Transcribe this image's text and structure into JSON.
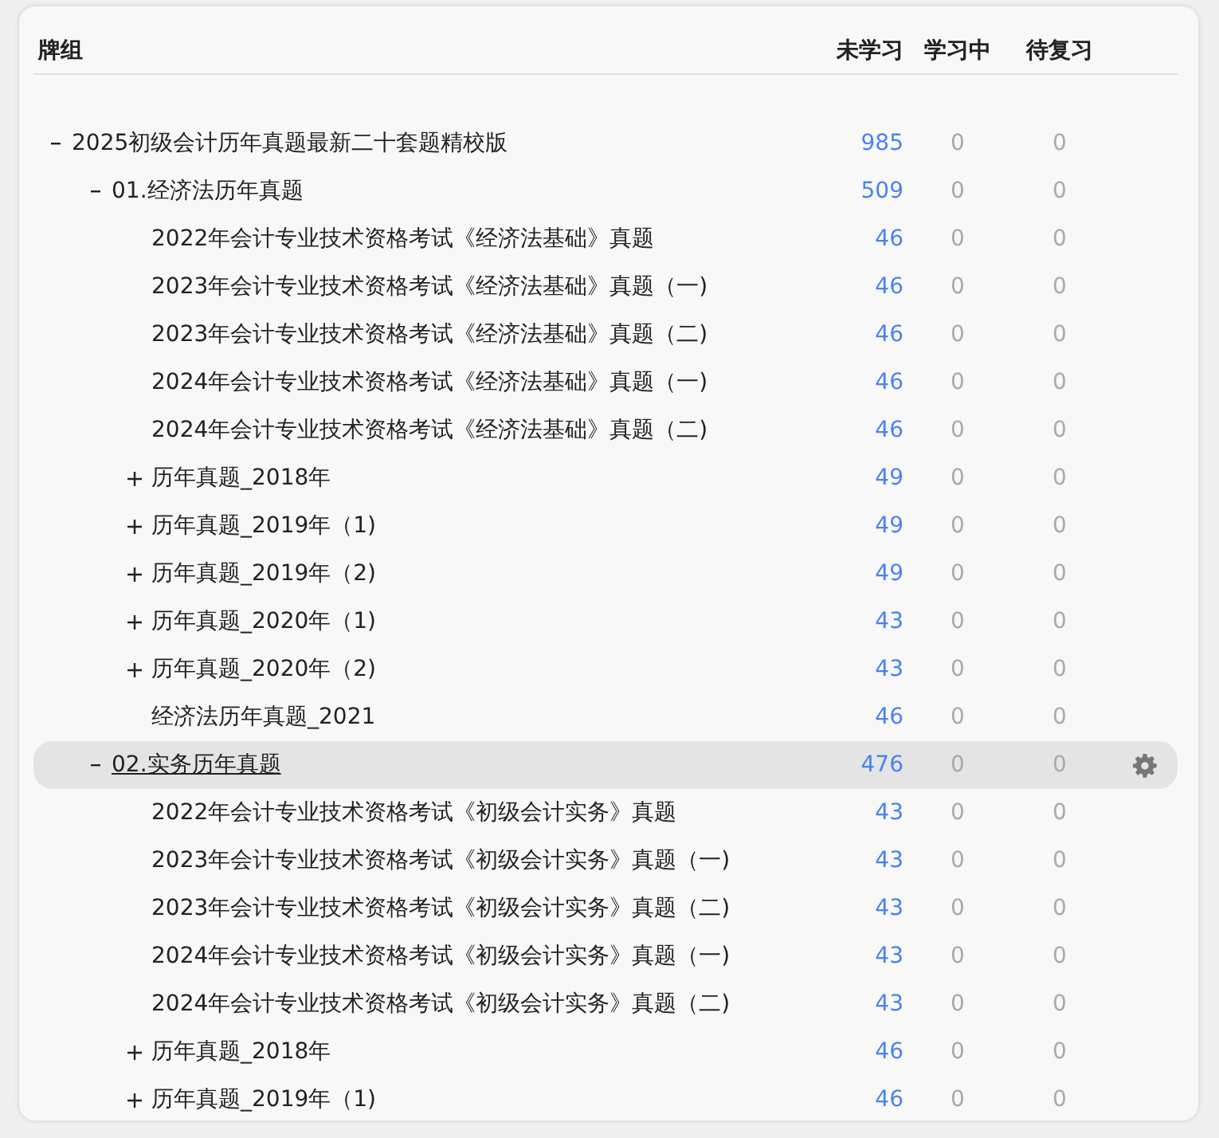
{
  "header": {
    "deck": "牌组",
    "new": "未学习",
    "learning": "学习中",
    "due": "待复习"
  },
  "decks": [
    {
      "name": "2025初级会计历年真题最新二十套题精校版",
      "new": "985",
      "learning": "0",
      "due": "0",
      "expanded": true,
      "selected": false,
      "children": [
        {
          "name": "01.经济法历年真题",
          "new": "509",
          "learning": "0",
          "due": "0",
          "expanded": true,
          "selected": false,
          "children": [
            {
              "name": "2022年会计专业技术资格考试《经济法基础》真题",
              "new": "46",
              "learning": "0",
              "due": "0",
              "selected": false
            },
            {
              "name": "2023年会计专业技术资格考试《经济法基础》真题（一)",
              "new": "46",
              "learning": "0",
              "due": "0",
              "selected": false
            },
            {
              "name": "2023年会计专业技术资格考试《经济法基础》真题（二)",
              "new": "46",
              "learning": "0",
              "due": "0",
              "selected": false
            },
            {
              "name": "2024年会计专业技术资格考试《经济法基础》真题（一)",
              "new": "46",
              "learning": "0",
              "due": "0",
              "selected": false
            },
            {
              "name": "2024年会计专业技术资格考试《经济法基础》真题（二)",
              "new": "46",
              "learning": "0",
              "due": "0",
              "selected": false
            },
            {
              "name": "历年真题_2018年",
              "new": "49",
              "learning": "0",
              "due": "0",
              "expanded": false,
              "selected": false
            },
            {
              "name": "历年真题_2019年（1)",
              "new": "49",
              "learning": "0",
              "due": "0",
              "expanded": false,
              "selected": false
            },
            {
              "name": "历年真题_2019年（2)",
              "new": "49",
              "learning": "0",
              "due": "0",
              "expanded": false,
              "selected": false
            },
            {
              "name": "历年真题_2020年（1)",
              "new": "43",
              "learning": "0",
              "due": "0",
              "expanded": false,
              "selected": false
            },
            {
              "name": "历年真题_2020年（2)",
              "new": "43",
              "learning": "0",
              "due": "0",
              "expanded": false,
              "selected": false
            },
            {
              "name": "经济法历年真题_2021",
              "new": "46",
              "learning": "0",
              "due": "0",
              "selected": false
            }
          ]
        },
        {
          "name": "02.实务历年真题",
          "new": "476",
          "learning": "0",
          "due": "0",
          "expanded": true,
          "selected": true,
          "children": [
            {
              "name": "2022年会计专业技术资格考试《初级会计实务》真题",
              "new": "43",
              "learning": "0",
              "due": "0",
              "selected": false
            },
            {
              "name": "2023年会计专业技术资格考试《初级会计实务》真题（一)",
              "new": "43",
              "learning": "0",
              "due": "0",
              "selected": false
            },
            {
              "name": "2023年会计专业技术资格考试《初级会计实务》真题（二)",
              "new": "43",
              "learning": "0",
              "due": "0",
              "selected": false
            },
            {
              "name": "2024年会计专业技术资格考试《初级会计实务》真题（一)",
              "new": "43",
              "learning": "0",
              "due": "0",
              "selected": false
            },
            {
              "name": "2024年会计专业技术资格考试《初级会计实务》真题（二)",
              "new": "43",
              "learning": "0",
              "due": "0",
              "selected": false
            },
            {
              "name": "历年真题_2018年",
              "new": "46",
              "learning": "0",
              "due": "0",
              "expanded": false,
              "selected": false
            },
            {
              "name": "历年真题_2019年（1)",
              "new": "46",
              "learning": "0",
              "due": "0",
              "expanded": false,
              "selected": false
            }
          ]
        }
      ]
    }
  ]
}
